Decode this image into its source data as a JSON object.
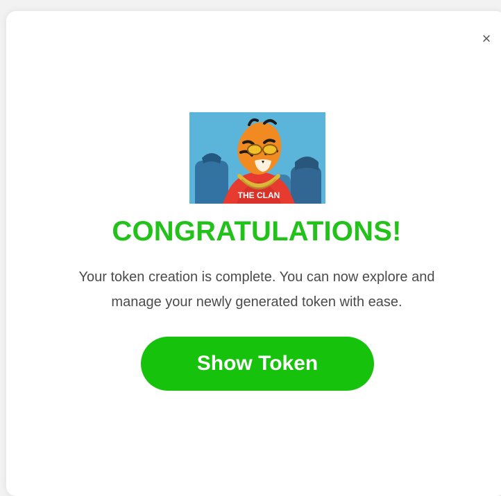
{
  "modal": {
    "close_symbol": "×",
    "hero_image": {
      "icon": "tiger-nft-image",
      "shirt_text": "THE CLAN"
    },
    "title": "CONGRATULATIONS!",
    "message_line1": "Your token creation is complete. You can now explore and",
    "message_line2": "manage your newly generated token with ease.",
    "button_label": "Show Token"
  },
  "colors": {
    "accent_green": "#17c20d",
    "title_green": "#22c21b",
    "hero_bg": "#5bb4d9",
    "text_gray": "#4a4a4a"
  }
}
